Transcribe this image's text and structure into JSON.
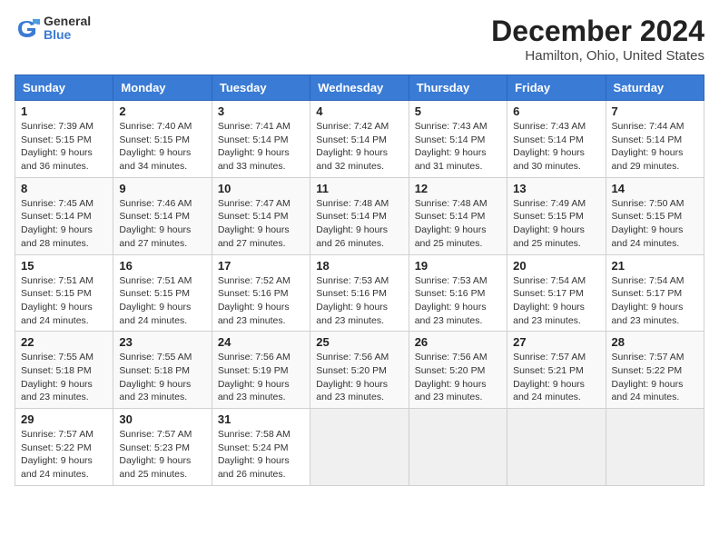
{
  "header": {
    "logo_line1": "General",
    "logo_line2": "Blue",
    "title": "December 2024",
    "subtitle": "Hamilton, Ohio, United States"
  },
  "calendar": {
    "weekdays": [
      "Sunday",
      "Monday",
      "Tuesday",
      "Wednesday",
      "Thursday",
      "Friday",
      "Saturday"
    ],
    "weeks": [
      [
        {
          "day": "1",
          "info": "Sunrise: 7:39 AM\nSunset: 5:15 PM\nDaylight: 9 hours and 36 minutes."
        },
        {
          "day": "2",
          "info": "Sunrise: 7:40 AM\nSunset: 5:15 PM\nDaylight: 9 hours and 34 minutes."
        },
        {
          "day": "3",
          "info": "Sunrise: 7:41 AM\nSunset: 5:14 PM\nDaylight: 9 hours and 33 minutes."
        },
        {
          "day": "4",
          "info": "Sunrise: 7:42 AM\nSunset: 5:14 PM\nDaylight: 9 hours and 32 minutes."
        },
        {
          "day": "5",
          "info": "Sunrise: 7:43 AM\nSunset: 5:14 PM\nDaylight: 9 hours and 31 minutes."
        },
        {
          "day": "6",
          "info": "Sunrise: 7:43 AM\nSunset: 5:14 PM\nDaylight: 9 hours and 30 minutes."
        },
        {
          "day": "7",
          "info": "Sunrise: 7:44 AM\nSunset: 5:14 PM\nDaylight: 9 hours and 29 minutes."
        }
      ],
      [
        {
          "day": "8",
          "info": "Sunrise: 7:45 AM\nSunset: 5:14 PM\nDaylight: 9 hours and 28 minutes."
        },
        {
          "day": "9",
          "info": "Sunrise: 7:46 AM\nSunset: 5:14 PM\nDaylight: 9 hours and 27 minutes."
        },
        {
          "day": "10",
          "info": "Sunrise: 7:47 AM\nSunset: 5:14 PM\nDaylight: 9 hours and 27 minutes."
        },
        {
          "day": "11",
          "info": "Sunrise: 7:48 AM\nSunset: 5:14 PM\nDaylight: 9 hours and 26 minutes."
        },
        {
          "day": "12",
          "info": "Sunrise: 7:48 AM\nSunset: 5:14 PM\nDaylight: 9 hours and 25 minutes."
        },
        {
          "day": "13",
          "info": "Sunrise: 7:49 AM\nSunset: 5:15 PM\nDaylight: 9 hours and 25 minutes."
        },
        {
          "day": "14",
          "info": "Sunrise: 7:50 AM\nSunset: 5:15 PM\nDaylight: 9 hours and 24 minutes."
        }
      ],
      [
        {
          "day": "15",
          "info": "Sunrise: 7:51 AM\nSunset: 5:15 PM\nDaylight: 9 hours and 24 minutes."
        },
        {
          "day": "16",
          "info": "Sunrise: 7:51 AM\nSunset: 5:15 PM\nDaylight: 9 hours and 24 minutes."
        },
        {
          "day": "17",
          "info": "Sunrise: 7:52 AM\nSunset: 5:16 PM\nDaylight: 9 hours and 23 minutes."
        },
        {
          "day": "18",
          "info": "Sunrise: 7:53 AM\nSunset: 5:16 PM\nDaylight: 9 hours and 23 minutes."
        },
        {
          "day": "19",
          "info": "Sunrise: 7:53 AM\nSunset: 5:16 PM\nDaylight: 9 hours and 23 minutes."
        },
        {
          "day": "20",
          "info": "Sunrise: 7:54 AM\nSunset: 5:17 PM\nDaylight: 9 hours and 23 minutes."
        },
        {
          "day": "21",
          "info": "Sunrise: 7:54 AM\nSunset: 5:17 PM\nDaylight: 9 hours and 23 minutes."
        }
      ],
      [
        {
          "day": "22",
          "info": "Sunrise: 7:55 AM\nSunset: 5:18 PM\nDaylight: 9 hours and 23 minutes."
        },
        {
          "day": "23",
          "info": "Sunrise: 7:55 AM\nSunset: 5:18 PM\nDaylight: 9 hours and 23 minutes."
        },
        {
          "day": "24",
          "info": "Sunrise: 7:56 AM\nSunset: 5:19 PM\nDaylight: 9 hours and 23 minutes."
        },
        {
          "day": "25",
          "info": "Sunrise: 7:56 AM\nSunset: 5:20 PM\nDaylight: 9 hours and 23 minutes."
        },
        {
          "day": "26",
          "info": "Sunrise: 7:56 AM\nSunset: 5:20 PM\nDaylight: 9 hours and 23 minutes."
        },
        {
          "day": "27",
          "info": "Sunrise: 7:57 AM\nSunset: 5:21 PM\nDaylight: 9 hours and 24 minutes."
        },
        {
          "day": "28",
          "info": "Sunrise: 7:57 AM\nSunset: 5:22 PM\nDaylight: 9 hours and 24 minutes."
        }
      ],
      [
        {
          "day": "29",
          "info": "Sunrise: 7:57 AM\nSunset: 5:22 PM\nDaylight: 9 hours and 24 minutes."
        },
        {
          "day": "30",
          "info": "Sunrise: 7:57 AM\nSunset: 5:23 PM\nDaylight: 9 hours and 25 minutes."
        },
        {
          "day": "31",
          "info": "Sunrise: 7:58 AM\nSunset: 5:24 PM\nDaylight: 9 hours and 26 minutes."
        },
        {
          "day": "",
          "info": ""
        },
        {
          "day": "",
          "info": ""
        },
        {
          "day": "",
          "info": ""
        },
        {
          "day": "",
          "info": ""
        }
      ]
    ]
  }
}
